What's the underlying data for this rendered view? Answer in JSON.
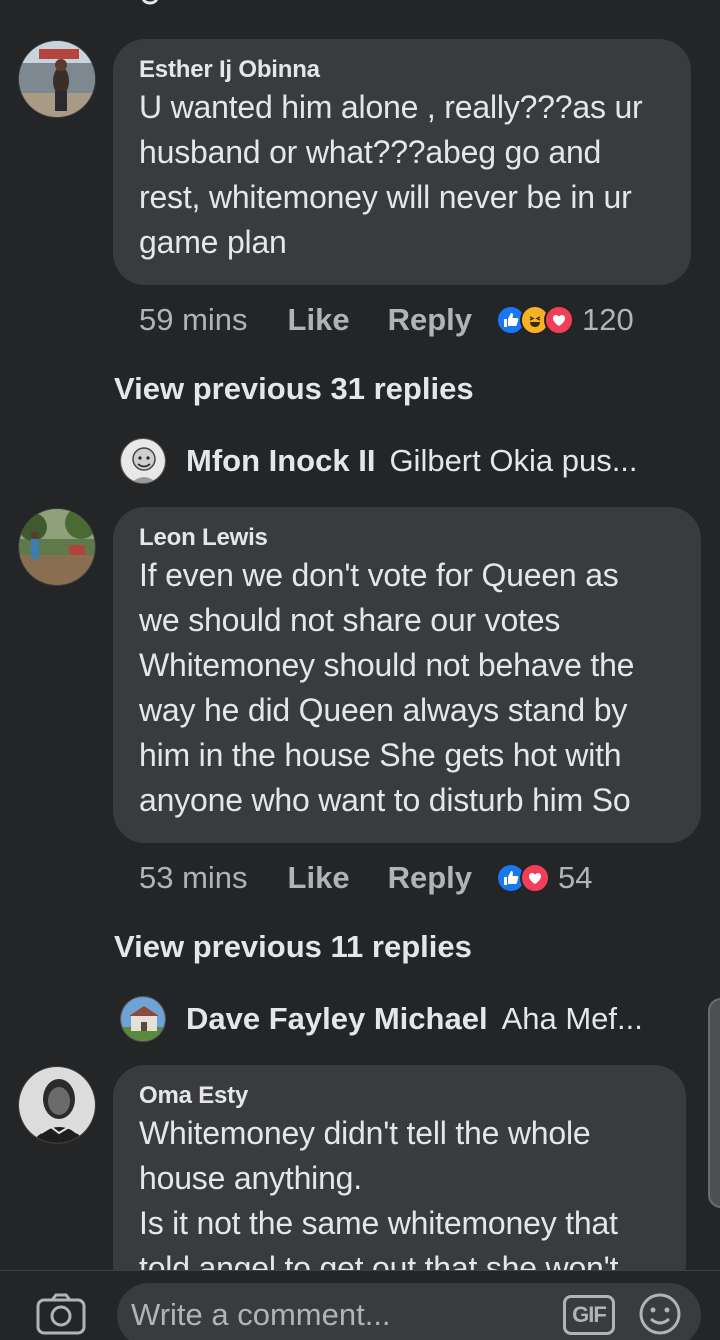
{
  "comments": [
    {
      "author": "Esther Ij Obinna",
      "text": "U wanted him alone , really???as ur\nhusband or what???abeg go and\nrest, whitemoney will never be in ur\ngame plan",
      "time": "59 mins",
      "like_label": "Like",
      "reply_label": "Reply",
      "reactions": [
        "like-icon",
        "haha-icon",
        "love-icon"
      ],
      "reaction_count": "120",
      "view_previous": "View previous 31 replies",
      "latest_reply": {
        "name": "Mfon Inock II",
        "text": "Gilbert Okia pus..."
      }
    },
    {
      "author": "Leon Lewis",
      "text": "If even we don't vote for Queen as\nwe should not share our votes\nWhitemoney should not behave the\nway he did  Queen always  stand by\nhim in the house  She gets hot with\nanyone who want to disturb him  So",
      "time": "53 mins",
      "like_label": "Like",
      "reply_label": "Reply",
      "reactions": [
        "like-icon",
        "love-icon"
      ],
      "reaction_count": "54",
      "view_previous": "View previous 11 replies",
      "latest_reply": {
        "name": "Dave Fayley Michael",
        "text": "Aha Mef..."
      }
    },
    {
      "author": "Oma Esty",
      "text": "Whitemoney didn't tell the whole\nhouse anything.\nIs it not the same whitemoney that\ntold angel to get out that she won't"
    }
  ],
  "composer": {
    "placeholder": "Write a comment...",
    "gif_label": "GIF"
  },
  "colors": {
    "background": "#242526",
    "bubble": "#3a3b3c",
    "like_blue": "#1877f2",
    "love_red": "#f33e58",
    "haha_yellow": "#f7b125"
  }
}
